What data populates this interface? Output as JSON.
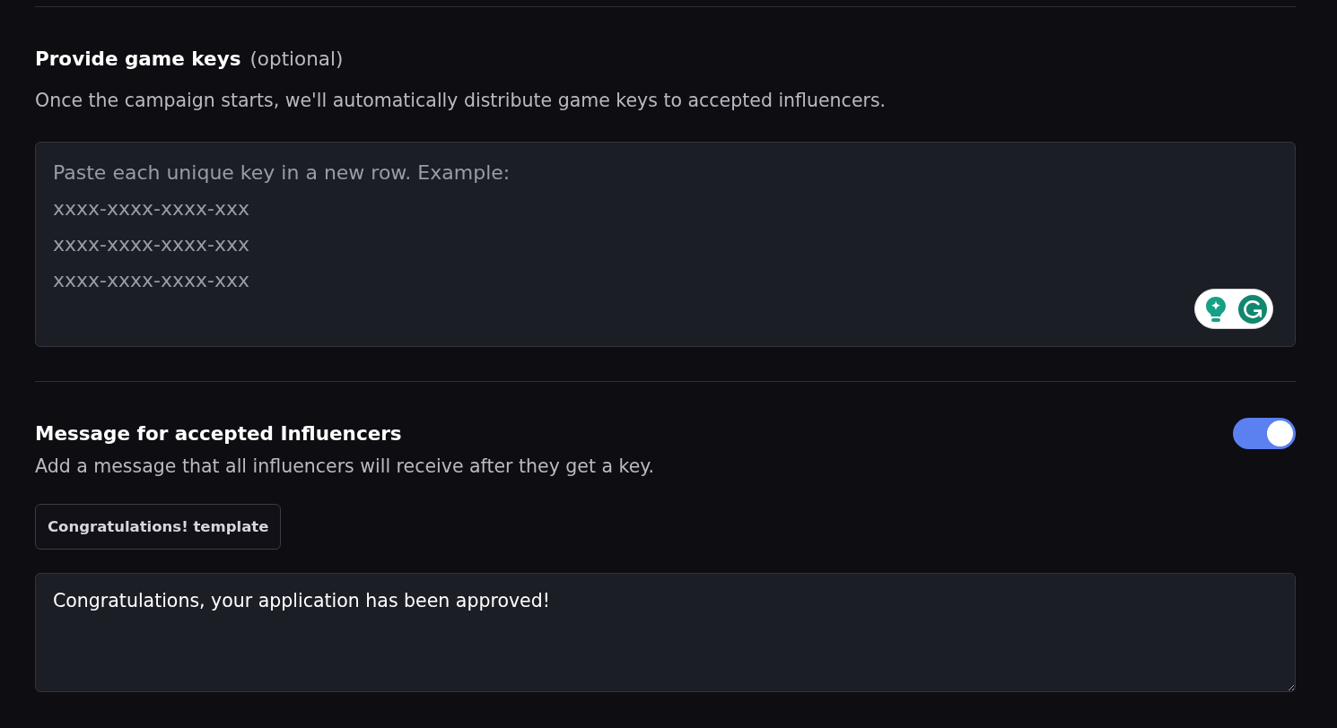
{
  "game_keys": {
    "title": "Provide game keys",
    "optional_note": "(optional)",
    "description": "Once the campaign starts, we'll automatically distribute game keys to accepted influencers.",
    "keys_field": {
      "placeholder": "Paste each unique key in a new row. Example:\nxxxx-xxxx-xxxx-xxx\nxxxx-xxxx-xxxx-xxx\nxxxx-xxxx-xxxx-xxx"
    }
  },
  "message": {
    "title": "Message for accepted Influencers",
    "toggle": {
      "on": true
    },
    "description": "Add a message that all influencers will receive after they get a key.",
    "template_button": {
      "label": "Congratulations! template"
    },
    "message_field": {
      "value": "Congratulations, your application has been approved!"
    }
  }
}
